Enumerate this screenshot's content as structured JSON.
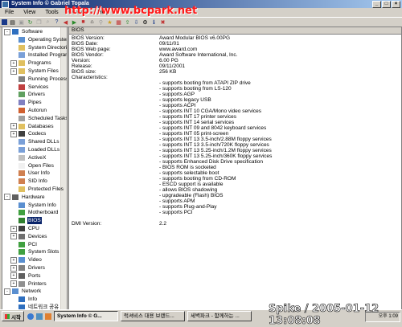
{
  "window": {
    "title": "System Info © Gabriel Topala"
  },
  "watermark": "http://www.bcpark.net",
  "menu": [
    "File",
    "View",
    "Tools",
    "Window",
    "Help"
  ],
  "toolbar_icons": [
    "save-icon",
    "print-icon",
    "properties-icon",
    "refresh-icon",
    "copy-icon",
    "find-icon",
    "help-icon",
    "back-icon",
    "forward-icon",
    "stop-icon",
    "home-icon",
    "search-icon",
    "favorites-icon",
    "report-icon",
    "export-icon",
    "import-icon",
    "settings-icon",
    "info-icon",
    "close-icon"
  ],
  "tree": [
    {
      "label": "Software",
      "level": 0,
      "exp": "-",
      "icon": "#2f6fbf"
    },
    {
      "label": "Operating System",
      "level": 1,
      "icon": "#5a8fd0"
    },
    {
      "label": "System Directories",
      "level": 1,
      "icon": "#e0c060"
    },
    {
      "label": "Installed Programs",
      "level": 1,
      "icon": "#7aa0d8"
    },
    {
      "label": "Programs",
      "level": 1,
      "exp": "+",
      "icon": "#e0c060"
    },
    {
      "label": "System Files",
      "level": 1,
      "exp": "+",
      "icon": "#e0c060"
    },
    {
      "label": "Running Processes",
      "level": 1,
      "icon": "#808080"
    },
    {
      "label": "Services",
      "level": 1,
      "icon": "#c04040"
    },
    {
      "label": "Drivers",
      "level": 1,
      "icon": "#60a060"
    },
    {
      "label": "Pipes",
      "level": 1,
      "icon": "#8080c0"
    },
    {
      "label": "Autorun",
      "level": 1,
      "icon": "#d06030"
    },
    {
      "label": "Scheduled Tasks",
      "level": 1,
      "icon": "#a0a0a0"
    },
    {
      "label": "Databases",
      "level": 1,
      "exp": "+",
      "icon": "#e0c060"
    },
    {
      "label": "Codecs",
      "level": 1,
      "exp": "+",
      "icon": "#404040"
    },
    {
      "label": "Shared DLLs",
      "level": 1,
      "icon": "#7aa0d8"
    },
    {
      "label": "Loaded DLLs",
      "level": 1,
      "icon": "#7aa0d8"
    },
    {
      "label": "ActiveX",
      "level": 1,
      "icon": "#c0c0c0"
    },
    {
      "label": "Open Files",
      "level": 1,
      "icon": "#f0f0f0"
    },
    {
      "label": "User Info",
      "level": 1,
      "icon": "#d08050"
    },
    {
      "label": "SID Info",
      "level": 1,
      "icon": "#d08050"
    },
    {
      "label": "Protected Files",
      "level": 1,
      "icon": "#e0c060"
    },
    {
      "label": "Hardware",
      "level": 0,
      "exp": "-",
      "icon": "#606060"
    },
    {
      "label": "System Info",
      "level": 1,
      "icon": "#5a8fd0"
    },
    {
      "label": "Motherboard",
      "level": 1,
      "icon": "#40a040"
    },
    {
      "label": "BIOS",
      "level": 1,
      "selected": true,
      "icon": "#308030"
    },
    {
      "label": "CPU",
      "level": 1,
      "exp": "+",
      "icon": "#404040"
    },
    {
      "label": "Devices",
      "level": 1,
      "exp": "+",
      "icon": "#707070"
    },
    {
      "label": "PCI",
      "level": 1,
      "icon": "#40a040"
    },
    {
      "label": "System Slots",
      "level": 1,
      "icon": "#40a040"
    },
    {
      "label": "Video",
      "level": 1,
      "exp": "+",
      "icon": "#5a8fd0"
    },
    {
      "label": "Drivers",
      "level": 1,
      "exp": "+",
      "icon": "#808080"
    },
    {
      "label": "Ports",
      "level": 1,
      "exp": "+",
      "icon": "#606060"
    },
    {
      "label": "Printers",
      "level": 1,
      "exp": "+",
      "icon": "#909090"
    },
    {
      "label": "Network",
      "level": 0,
      "exp": "-",
      "icon": "#5a8fd0"
    },
    {
      "label": "Info",
      "level": 1,
      "icon": "#2f6fbf"
    },
    {
      "label": "네트워크 공유",
      "level": 1,
      "icon": "#2f6fbf"
    }
  ],
  "detail": {
    "header": "BIOS",
    "rows": [
      {
        "key": "BIOS Version:",
        "value": "Award Modular BIOS v6.00PG"
      },
      {
        "key": "BIOS Date:",
        "value": "09/11/01"
      },
      {
        "key": "BIOS Web page:",
        "value": "www.award.com"
      },
      {
        "key": "BIOS Vendor:",
        "value": "Award Software International, Inc."
      },
      {
        "key": "Version:",
        "value": "6.00 PG"
      },
      {
        "key": "Release:",
        "value": "09/11/2001"
      },
      {
        "key": "BIOS size:",
        "value": "256 KB"
      },
      {
        "key": "Characteristics:",
        "value": ""
      },
      {
        "key": "",
        "value": "- supports booting from ATAPI ZIP drive"
      },
      {
        "key": "",
        "value": "- supports booting from LS-120"
      },
      {
        "key": "",
        "value": "- supports AGP"
      },
      {
        "key": "",
        "value": "- supports legacy USB"
      },
      {
        "key": "",
        "value": "- supports ACPI"
      },
      {
        "key": "",
        "value": "- supports INT 10 CGA/Mono video services"
      },
      {
        "key": "",
        "value": "- supports INT 17 printer services"
      },
      {
        "key": "",
        "value": "- supports INT 14 serial services"
      },
      {
        "key": "",
        "value": "- supports INT 09 and 8042 keyboard services"
      },
      {
        "key": "",
        "value": "- supports INT 05 print-screen"
      },
      {
        "key": "",
        "value": "- supports INT 13 3.5-inch/2.88M floppy services"
      },
      {
        "key": "",
        "value": "- supports INT 13 3.5-inch/720K floppy services"
      },
      {
        "key": "",
        "value": "- supports INT 13 5.25-inch/1.2M floppy services"
      },
      {
        "key": "",
        "value": "- supports INT 13 5.25-inch/360K floppy services"
      },
      {
        "key": "",
        "value": "- supports Enhanced Disk Drive specification"
      },
      {
        "key": "",
        "value": "- BIOS ROM is socketed"
      },
      {
        "key": "",
        "value": "- supports selectable boot"
      },
      {
        "key": "",
        "value": "- supports booting from CD-ROM"
      },
      {
        "key": "",
        "value": "- ESCD support is available"
      },
      {
        "key": "",
        "value": "- allows BIOS shadowing"
      },
      {
        "key": "",
        "value": "- upgradeable (Flash) BIOS"
      },
      {
        "key": "",
        "value": "- supports APM"
      },
      {
        "key": "",
        "value": "- supports Plug-and-Play"
      },
      {
        "key": "",
        "value": "- supports PCI"
      },
      {
        "key": "",
        "value": ""
      },
      {
        "key": "DMI Version:",
        "value": "2.2"
      }
    ]
  },
  "taskbar": {
    "start": "시작",
    "tasks": [
      {
        "label": "System Info © G...",
        "active": true
      },
      {
        "label": "럭셔비스 대용 브랜드...",
        "active": false
      },
      {
        "label": "세벽파크 - 함께하는 ...",
        "active": false
      }
    ],
    "clock": "오후 1:09"
  },
  "stamp": "Spike / 2005-01-12 13:08:08"
}
